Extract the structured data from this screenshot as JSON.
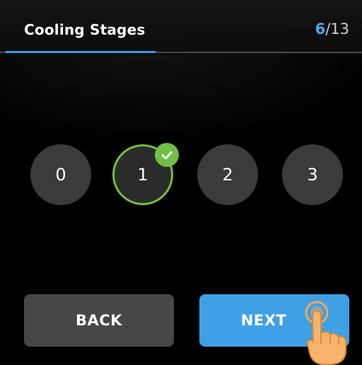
{
  "header": {
    "title": "Cooling Stages",
    "step_current": "6",
    "step_separator": "/",
    "step_total": "13"
  },
  "options": [
    {
      "label": "0",
      "selected": false
    },
    {
      "label": "1",
      "selected": true
    },
    {
      "label": "2",
      "selected": false
    },
    {
      "label": "3",
      "selected": false
    }
  ],
  "buttons": {
    "back_label": "BACK",
    "next_label": "NEXT"
  },
  "colors": {
    "accent_blue": "#3fa0e6",
    "selected_green": "#71c043",
    "option_gray": "#3b3b3b",
    "back_gray": "#474747",
    "background": "#000000"
  },
  "icons": {
    "check": "check-icon",
    "hand": "tap-hand-icon"
  }
}
